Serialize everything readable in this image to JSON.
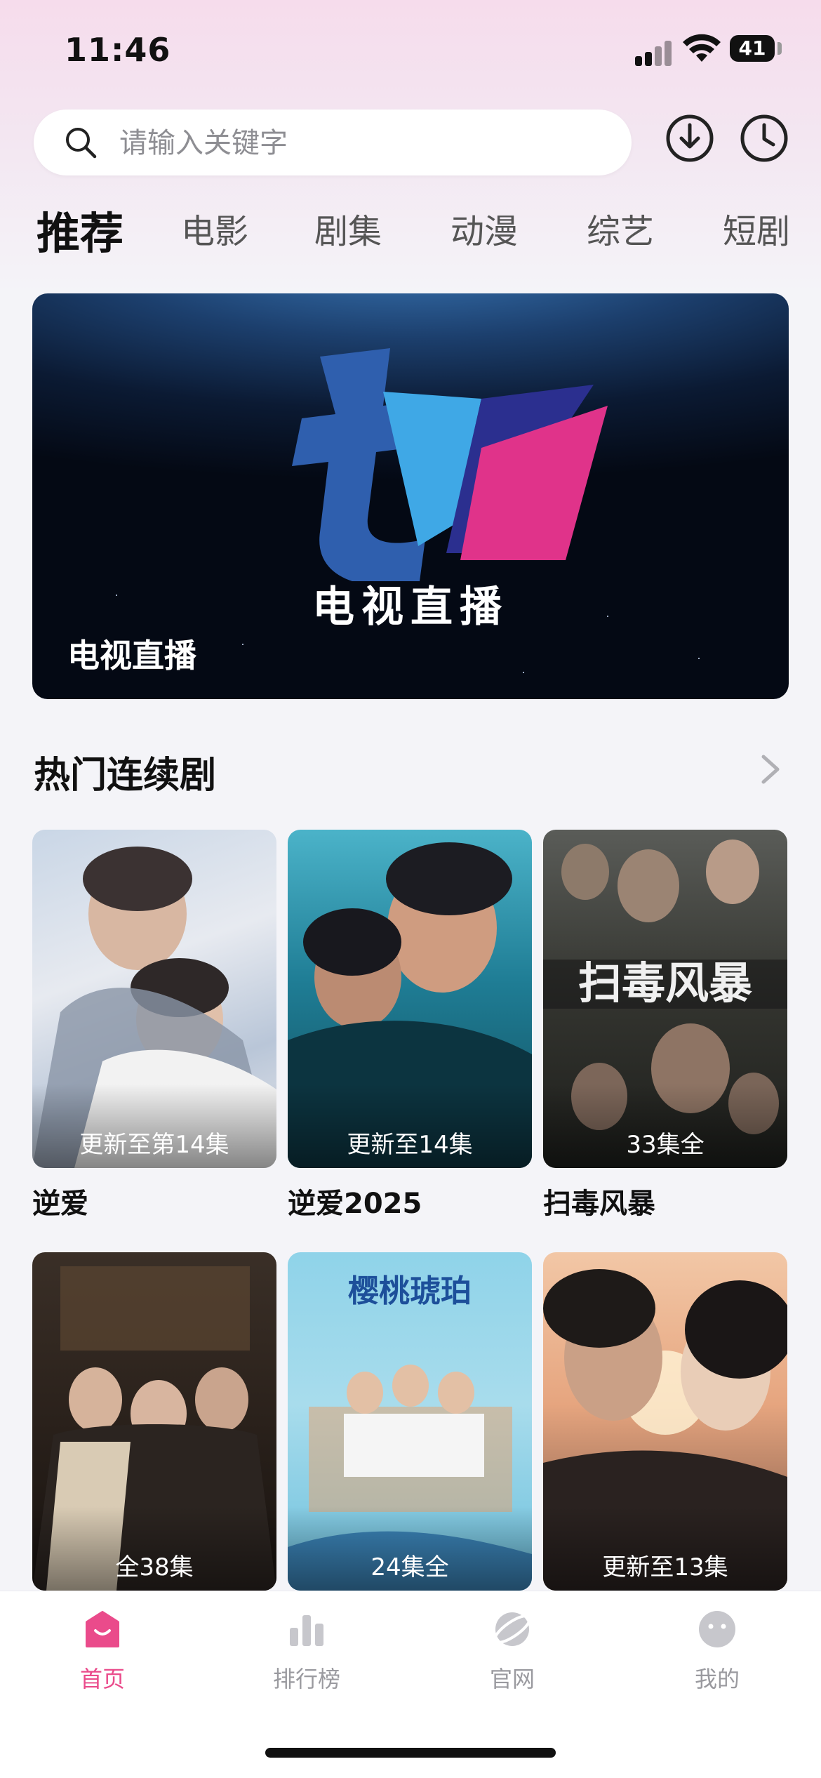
{
  "status": {
    "time": "11:46",
    "battery": "41"
  },
  "search": {
    "placeholder": "请输入关键字"
  },
  "tabs": [
    {
      "label": "推荐",
      "active": true
    },
    {
      "label": "电影"
    },
    {
      "label": "剧集"
    },
    {
      "label": "动漫"
    },
    {
      "label": "综艺"
    },
    {
      "label": "短剧"
    }
  ],
  "banner": {
    "logo_text": "tv",
    "center_text": "电视直播",
    "caption": "电视直播"
  },
  "section": {
    "title": "热门连续剧"
  },
  "cards": [
    {
      "title": "逆爱",
      "badge": "更新至第14集"
    },
    {
      "title": "逆爱2025",
      "badge": "更新至14集"
    },
    {
      "title": "扫毒风暴",
      "badge": "33集全"
    },
    {
      "title": "",
      "badge": "全38集"
    },
    {
      "title": "",
      "badge": "24集全"
    },
    {
      "title": "",
      "badge": "更新至13集"
    }
  ],
  "nav": [
    {
      "label": "首页",
      "icon": "home-icon",
      "active": true
    },
    {
      "label": "排行榜",
      "icon": "ranking-icon"
    },
    {
      "label": "官网",
      "icon": "website-icon"
    },
    {
      "label": "我的",
      "icon": "profile-icon"
    }
  ],
  "colors": {
    "accent": "#ea4b8b",
    "inactive": "#9a9a9f"
  }
}
